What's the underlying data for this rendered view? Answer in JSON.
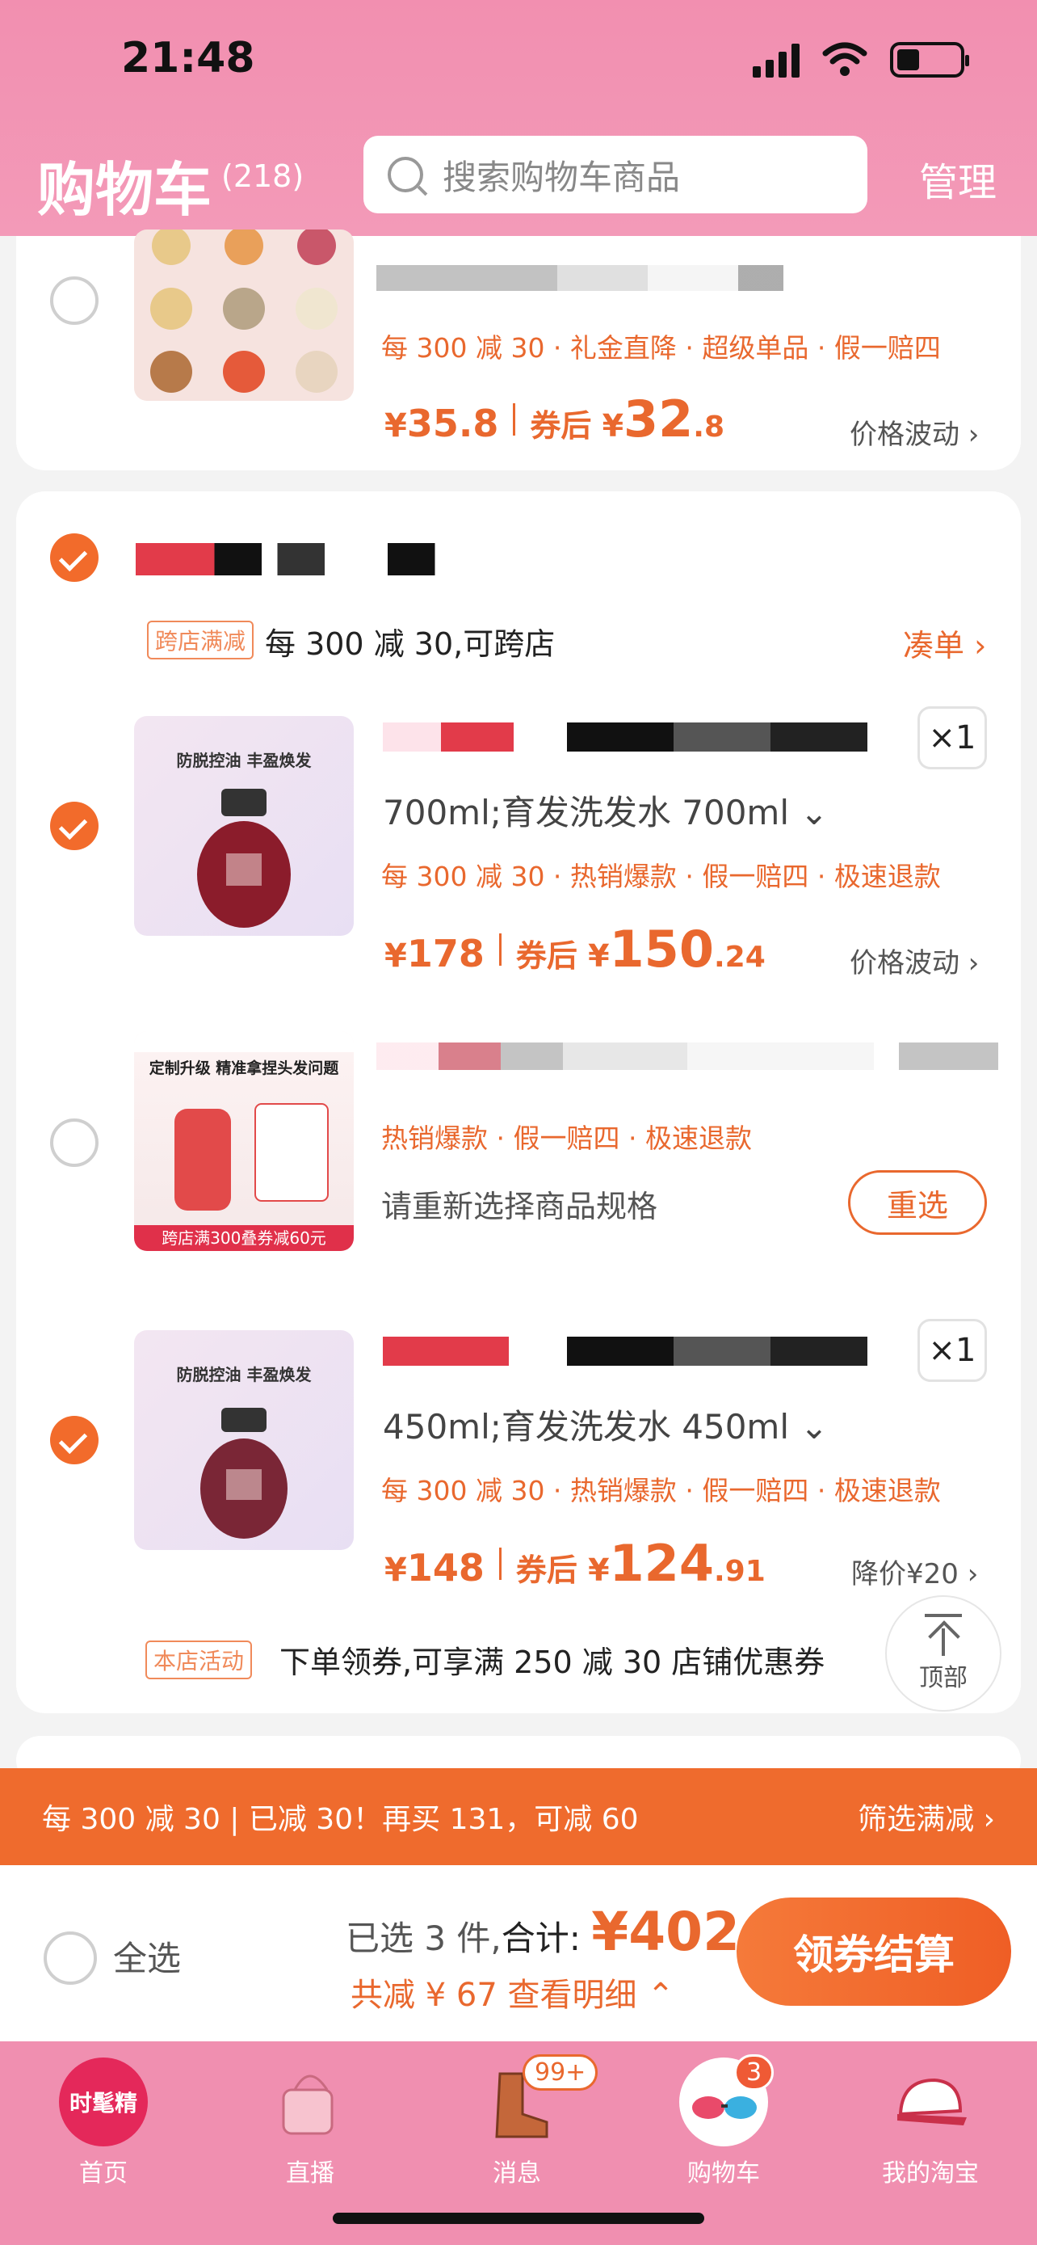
{
  "status_bar": {
    "time": "21:48"
  },
  "header": {
    "title": "购物车",
    "count": "(218)",
    "search_placeholder": "搜索购物车商品",
    "manage": "管理"
  },
  "item_top": {
    "promos": "每 300 减 30 · 礼金直降 · 超级单品 · 假一赔四",
    "price_yen": "¥",
    "price": "35.8",
    "after_label": "券后 ¥",
    "after_int": "32",
    "after_dec": ".8",
    "side_link": "价格波动 ›"
  },
  "shop": {
    "promo_tag": "跨店满减",
    "promo_text": "每 300 减 30,可跨店",
    "promo_link": "凑单 ›",
    "items": [
      {
        "qty": "×1",
        "variant": "700ml;育发洗发水 700ml ⌄",
        "promos": "每 300 减 30 · 热销爆款 · 假一赔四 · 极速退款",
        "price_yen": "¥",
        "price": "178",
        "after_label": "券后 ¥",
        "after_int": "150",
        "after_dec": ".24",
        "side_link": "价格波动 ›"
      },
      {
        "promos": "热销爆款 · 假一赔四 · 极速退款",
        "hint": "请重新选择商品规格",
        "reselect": "重选"
      },
      {
        "qty": "×1",
        "variant": "450ml;育发洗发水 450ml ⌄",
        "promos": "每 300 减 30 · 热销爆款 · 假一赔四 · 极速退款",
        "price_yen": "¥",
        "price": "148",
        "after_label": "券后 ¥",
        "after_int": "124",
        "after_dec": ".91",
        "side_link": "降价¥20 ›"
      }
    ],
    "activity_tag": "本店活动",
    "activity_text": "下单领券,可享满 250 减 30 店铺优惠券"
  },
  "back_to_top": "顶部",
  "promo_bar": {
    "left": "每 300 减 30 | 已减 30！再买 131，可减 60",
    "right": "筛选满减 ›"
  },
  "checkout": {
    "select_all": "全选",
    "selected": "已选 3 件,",
    "total_label": "合计: ",
    "total_yen": "¥",
    "total": "402",
    "savings": "共减 ¥ 67 查看明细 ⌃",
    "button": "领券结算"
  },
  "tabbar": {
    "items": [
      {
        "label": "首页",
        "icon": "home-fashion-icon"
      },
      {
        "label": "直播",
        "icon": "live-bag-icon"
      },
      {
        "label": "消息",
        "icon": "message-boot-icon",
        "badge": "99+"
      },
      {
        "label": "购物车",
        "icon": "cart-glasses-icon",
        "badge": "3"
      },
      {
        "label": "我的淘宝",
        "icon": "my-taobao-cap-icon"
      }
    ],
    "home_icon_text": "时髦精"
  },
  "colors": {
    "accent": "#ef6b2d",
    "header_pink": "#f28fb0",
    "price": "#e9682e"
  }
}
